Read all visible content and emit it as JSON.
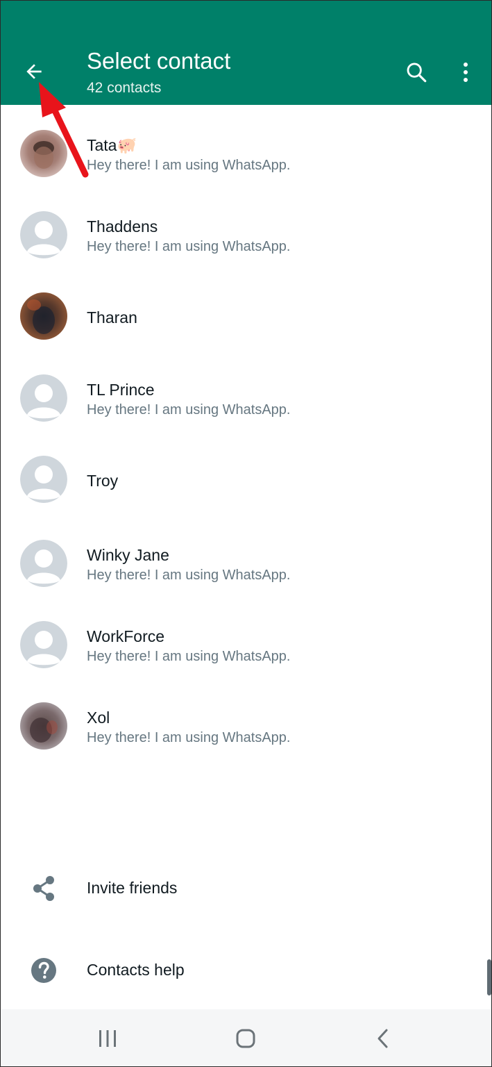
{
  "header": {
    "title": "Select contact",
    "subtitle": "42 contacts",
    "background": "#008069"
  },
  "contacts": [
    {
      "name": "Tata🐖",
      "status": "Hey there! I am using WhatsApp.",
      "avatar": "photo"
    },
    {
      "name": "Thaddens",
      "status": "Hey there! I am using WhatsApp.",
      "avatar": "default"
    },
    {
      "name": "Tharan",
      "status": "",
      "avatar": "photo"
    },
    {
      "name": "TL Prince",
      "status": "Hey there! I am using WhatsApp.",
      "avatar": "default"
    },
    {
      "name": "Troy",
      "status": "",
      "avatar": "default"
    },
    {
      "name": "Winky Jane",
      "status": "Hey there! I am using WhatsApp.",
      "avatar": "default"
    },
    {
      "name": "WorkForce",
      "status": "Hey there! I am using WhatsApp.",
      "avatar": "default"
    },
    {
      "name": "Xol",
      "status": "Hey there! I am using WhatsApp.",
      "avatar": "photo"
    }
  ],
  "actions": {
    "invite": "Invite friends",
    "help": "Contacts help"
  },
  "icons": {
    "back": "arrow-left-icon",
    "search": "search-icon",
    "menu": "more-vert-icon",
    "share": "share-icon",
    "help": "help-icon",
    "annotation": "red-arrow-icon"
  },
  "colors": {
    "accent": "#008069",
    "annotation_arrow": "#e8141b"
  }
}
